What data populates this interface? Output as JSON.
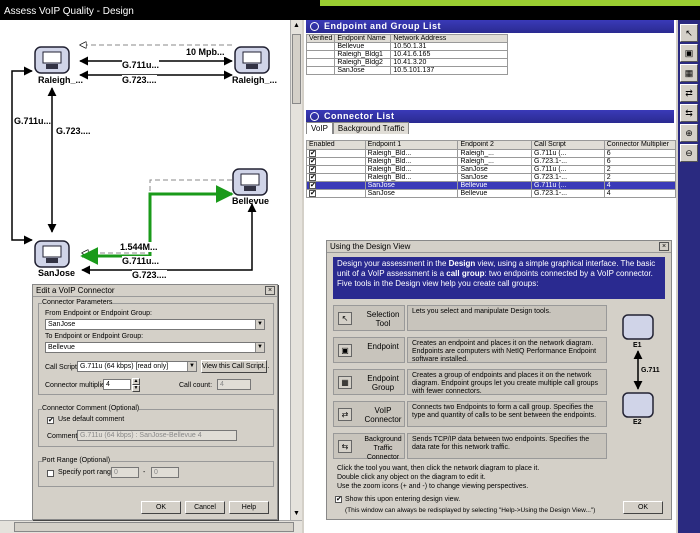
{
  "window": {
    "title": "Assess VoIP Quality - Design"
  },
  "diagram": {
    "nodes": {
      "raleigh1": "Raleigh_...",
      "bellevue": "Bellevue",
      "sanjose": "SanJose"
    },
    "edges": {
      "e1": "10 Mpb...",
      "e2": "G.711u...",
      "e3": "G.723....",
      "e4": "G.711u...",
      "e5": "G.723....",
      "e6": "1.544M...",
      "e7": "G.711u...",
      "e8": "G.723...."
    }
  },
  "endpoint_list": {
    "title": "Endpoint and Group List",
    "headers": [
      "Verified",
      "Endpoint Name",
      "Network Address"
    ],
    "rows": [
      [
        "",
        "Bellevue",
        "10.50.1.31"
      ],
      [
        "",
        "Raleigh_Bldg1",
        "10.41.6.165"
      ],
      [
        "",
        "Raleigh_Bldg2",
        "10.41.3.20"
      ],
      [
        "",
        "SanJose",
        "10.5.101.137"
      ]
    ]
  },
  "connector_list": {
    "title": "Connector List",
    "tabs": [
      "VoIP",
      "Background Traffic"
    ],
    "headers": [
      "Enabled",
      "Endpoint 1",
      "Endpoint 2",
      "Call Script",
      "Connector Multiplier"
    ],
    "rows": [
      [
        "✔",
        "Raleigh_Bld...",
        "Raleigh_...",
        "G.711u (...",
        "6"
      ],
      [
        "✔",
        "Raleigh_Bld...",
        "Raleigh_...",
        "G.723.1-...",
        "6"
      ],
      [
        "✔",
        "Raleigh_Bld...",
        "SanJose",
        "G.711u (...",
        "2"
      ],
      [
        "✔",
        "Raleigh_Bld...",
        "SanJose",
        "G.723.1-...",
        "2"
      ],
      [
        "✔",
        "SanJose",
        "Bellevue",
        "G.711u (...",
        "4"
      ],
      [
        "✔",
        "SanJose",
        "Bellevue",
        "G.723.1-...",
        "4"
      ]
    ]
  },
  "dialog": {
    "title": "Edit a VoIP Connector",
    "params_label": "Connector Parameters",
    "from_label": "From Endpoint or Endpoint Group:",
    "from_value": "SanJose",
    "to_label": "To Endpoint or Endpoint Group:",
    "to_value": "Bellevue",
    "script_label": "Call Script:",
    "script_value": "G.711u (64 kbps) [read only]",
    "view_script": "View this Call Script...",
    "multiplier_label": "Connector multiplier:",
    "multiplier_value": "4",
    "call_count_label": "Call count:",
    "call_count_value": "4",
    "comment_group": "Connector Comment (Optional)",
    "use_default": "Use default comment",
    "comment_label": "Comment:",
    "comment_value": "G.711u (64 kbps) : SanJose-Bellevue 4",
    "port_group": "Port Range (Optional)",
    "specify_port": "Specify port range",
    "port_from": "0",
    "port_to": "0",
    "dash": "-",
    "ok": "OK",
    "cancel": "Cancel",
    "help": "Help",
    "close_glyph": "×"
  },
  "help": {
    "title": "Using the Design View",
    "banner_pre": "Design your assessment in the ",
    "banner_bold1": "Design",
    "banner_mid": " view, using a simple graphical interface. The basic unit of a VoIP assessment is a ",
    "banner_bold2": "call group",
    "banner_post": ": two endpoints connected by a VoIP connector.",
    "banner_line3": "Five tools in the Design view help you create call groups:",
    "tools": [
      {
        "name": "Selection Tool",
        "desc": "Lets you select and manipulate Design tools."
      },
      {
        "name": "Endpoint",
        "desc": "Creates an endpoint and places it on the network diagram. Endpoints are computers with NetIQ Performance Endpoint software installed."
      },
      {
        "name": "Endpoint Group",
        "desc": "Creates a group of endpoints and places it on the network diagram. Endpoint groups let you create multiple call groups with fewer connectors."
      },
      {
        "name": "VoIP Connector",
        "desc": "Connects two Endpoints to form a call group. Specifies the type and quantity of calls to be sent between the endpoints."
      },
      {
        "name": "Background Traffic Connector",
        "desc": "Sends TCP/IP data between two endpoints. Specifies the data rate for this network traffic."
      }
    ],
    "footer1": "Click the tool you want, then click the network diagram to place it.",
    "footer2": "Double click any object on the diagram to edit it.",
    "footer3": "Use the zoom icons (+ and -) to change viewing perspectives.",
    "show_label": "Show this upon entering design view.",
    "redisplay": "(This window can always be redisplayed by selecting \"Help->Using the Design View...\")",
    "ok": "OK",
    "e1": "E1",
    "e2": "E2",
    "codec": "G.711",
    "close_glyph": "×"
  },
  "toolbar": [
    "selection-tool",
    "endpoint-tool",
    "endpoint-group-tool",
    "voip-connector-tool",
    "background-traffic-tool",
    "zoom-in-tool",
    "zoom-out-tool"
  ],
  "colors": {
    "title_bg": "#000000",
    "accent_green": "#9acd32",
    "panel_blue": "#2a2a90",
    "connector_green": "#1a9a1a"
  }
}
